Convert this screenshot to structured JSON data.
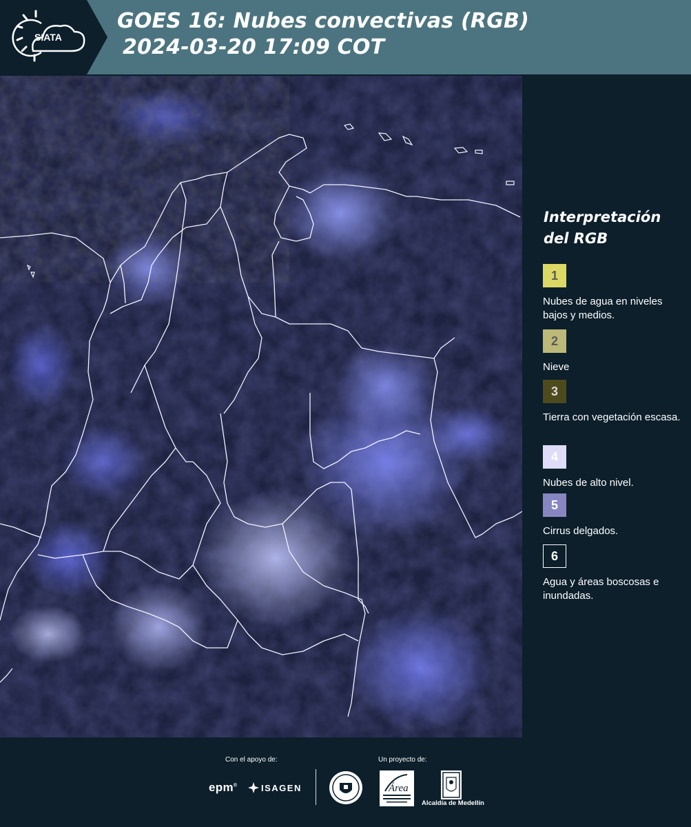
{
  "header": {
    "logo_text": "SIATA",
    "title_line1": "GOES 16: Nubes convectivas (RGB)",
    "title_line2": "2024-03-20 17:09 COT",
    "background": "#4c7480",
    "logo_background": "#0c1f2b"
  },
  "map": {
    "image": "satellite-rgb-composite-colombia",
    "dominant_colors": [
      "#1e2240",
      "#5b62f0",
      "#c8ccff",
      "#4c4a2a"
    ]
  },
  "legend": {
    "title": "Interpretación del RGB",
    "items": [
      {
        "number": "1",
        "color": "#dcd864",
        "label": "Nubes de agua en niveles bajos y medios."
      },
      {
        "number": "2",
        "color": "#bcb878",
        "label": "Nieve"
      },
      {
        "number": "3",
        "color": "#4e4a1c",
        "label": "Tierra con vegetación escasa."
      },
      {
        "number": "4",
        "color": "#dedcf6",
        "label": "Nubes de alto nivel."
      },
      {
        "number": "5",
        "color": "#8886c2",
        "label": "Cirrus delgados."
      },
      {
        "number": "6",
        "color": "#0c1f2b",
        "label": "Agua y áreas boscosas e inundadas."
      }
    ]
  },
  "footer": {
    "support_label": "Con el apoyo de:",
    "project_label": "Un proyecto de:",
    "sponsor1": "epm",
    "sponsor2": "ISAGEN",
    "partner_area": "Área Metropolitana Valle de Aburrá",
    "partner_medellin": "Alcaldía de Medellín"
  }
}
